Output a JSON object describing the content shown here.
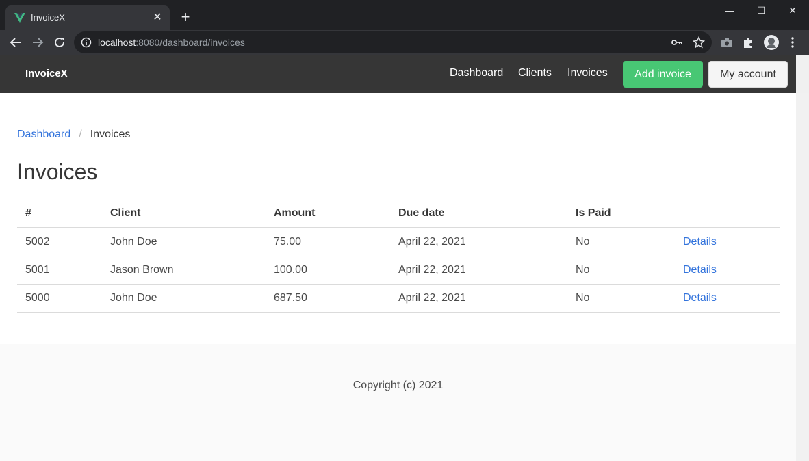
{
  "browser": {
    "tab_title": "InvoiceX",
    "tab_close": "✕",
    "new_tab": "+",
    "url_host": "localhost",
    "url_rest": ":8080/dashboard/invoices",
    "window": {
      "minimize": "—",
      "maximize": "☐",
      "close": "✕"
    }
  },
  "navbar": {
    "brand": "InvoiceX",
    "links": [
      "Dashboard",
      "Clients",
      "Invoices"
    ],
    "add_invoice": "Add invoice",
    "my_account": "My account"
  },
  "breadcrumb": {
    "parent": "Dashboard",
    "separator": "/",
    "current": "Invoices"
  },
  "page_title": "Invoices",
  "table": {
    "headers": [
      "#",
      "Client",
      "Amount",
      "Due date",
      "Is Paid",
      ""
    ],
    "rows": [
      {
        "number": "5002",
        "client": "John Doe",
        "amount": "75.00",
        "due": "April 22, 2021",
        "paid": "No",
        "action": "Details"
      },
      {
        "number": "5001",
        "client": "Jason Brown",
        "amount": "100.00",
        "due": "April 22, 2021",
        "paid": "No",
        "action": "Details"
      },
      {
        "number": "5000",
        "client": "John Doe",
        "amount": "687.50",
        "due": "April 22, 2021",
        "paid": "No",
        "action": "Details"
      }
    ]
  },
  "footer": {
    "text": "Copyright (c) 2021"
  },
  "colors": {
    "navbar": "#363636",
    "success": "#48c774",
    "link": "#3273dc"
  }
}
